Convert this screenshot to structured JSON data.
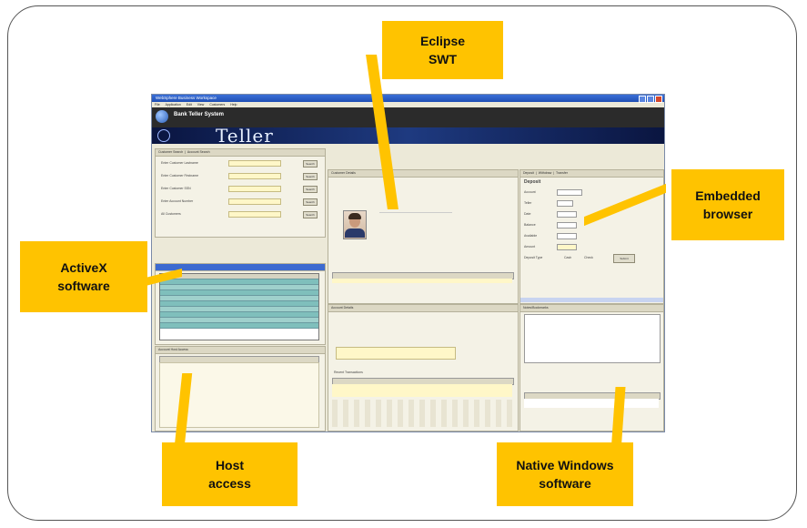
{
  "app": {
    "window_title": "WebSphere Business Workspace",
    "banner_title": "Bank Teller System",
    "banner_brand": "Teller",
    "menu": [
      "File",
      "Application",
      "Edit",
      "View",
      "Customers",
      "Help"
    ]
  },
  "panels": {
    "customer_search": "Customer Search",
    "account_search": "Account Search",
    "customer_details": "Customer Details",
    "account_details": "Account Details",
    "deposit_tab": "Deposit",
    "withdraw_tab": "Withdraw",
    "transfer_tab": "Transfer",
    "recent_transactions": "Recent Transactions",
    "host_panel": "Account Host Access",
    "native_panel": "Notes/Bookmarks"
  },
  "search_labels": [
    "Enter Customer Lastname",
    "Enter Customer Firstname",
    "Enter Customer SSN",
    "Enter Account Number",
    "All Customers"
  ],
  "search_button": "Search",
  "deposit": {
    "title": "Deposit",
    "labels": [
      "Account",
      "Teller",
      "Date",
      "Balance",
      "Available",
      "Amount",
      "Deposit Type"
    ],
    "radio_cash": "Cash",
    "radio_check": "Check",
    "submit": "Submit"
  },
  "callouts": {
    "eclipse": [
      "Eclipse",
      "SWT"
    ],
    "embedded": [
      "Embedded",
      "browser"
    ],
    "activex": [
      "ActiveX",
      "software"
    ],
    "host": [
      "Host",
      "access"
    ],
    "native": [
      "Native Windows",
      "software"
    ]
  },
  "colors": {
    "callout": "#ffc300",
    "titlebar": "#1f4fb4",
    "grid_teal": "#7fbfbc",
    "field_yellow": "#fff7c8"
  }
}
